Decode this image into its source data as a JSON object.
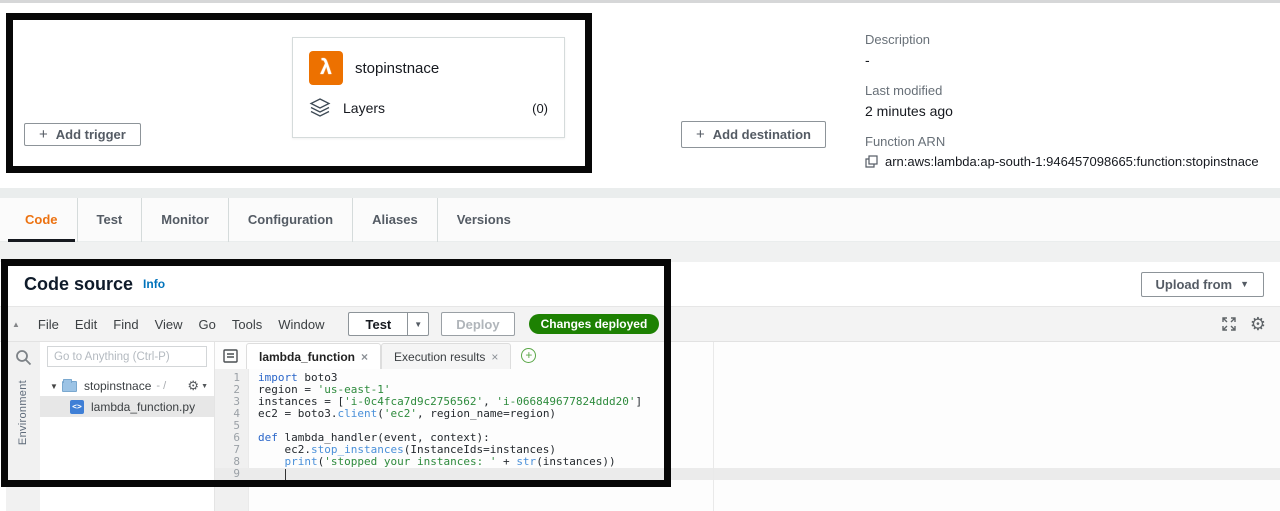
{
  "overview": {
    "function_card": {
      "name": "stopinstnace",
      "layers_label": "Layers",
      "layers_count": "(0)"
    },
    "add_trigger_label": "Add trigger",
    "add_destination_label": "Add destination",
    "plus_glyph": "+",
    "description_label": "Description",
    "description_value": "-",
    "last_modified_label": "Last modified",
    "last_modified_value": "2 minutes ago",
    "function_arn_label": "Function ARN",
    "function_arn_value": "arn:aws:lambda:ap-south-1:946457098665:function:stopinstnace"
  },
  "tabs": {
    "items": [
      {
        "label": "Code",
        "active": true
      },
      {
        "label": "Test"
      },
      {
        "label": "Monitor"
      },
      {
        "label": "Configuration"
      },
      {
        "label": "Aliases"
      },
      {
        "label": "Versions"
      }
    ]
  },
  "code_source": {
    "title": "Code source",
    "info_link": "Info",
    "upload_from_label": "Upload from",
    "toolbar": {
      "menus": [
        "File",
        "Edit",
        "Find",
        "View",
        "Go",
        "Tools",
        "Window"
      ],
      "test_label": "Test",
      "deploy_label": "Deploy",
      "changes_badge": "Changes deployed"
    },
    "sidebar": {
      "search_placeholder": "Go to Anything (Ctrl-P)",
      "environment_label": "Environment",
      "folder_name": "stopinstnace",
      "folder_suffix": "- /",
      "file_name": "lambda_function.py",
      "file_icon_glyph": "<>"
    },
    "editor": {
      "tabs": [
        {
          "label": "lambda_function"
        },
        {
          "label": "Execution results"
        }
      ],
      "close_glyph": "×",
      "highlighted_line": 9,
      "code_lines": [
        [
          {
            "t": "kw",
            "v": "import"
          },
          {
            "t": "pl",
            "v": " boto3"
          }
        ],
        [
          {
            "t": "pl",
            "v": "region = "
          },
          {
            "t": "str",
            "v": "'us-east-1'"
          }
        ],
        [
          {
            "t": "pl",
            "v": "instances = ["
          },
          {
            "t": "str",
            "v": "'i-0c4fca7d9c2756562'"
          },
          {
            "t": "pl",
            "v": ", "
          },
          {
            "t": "str",
            "v": "'i-066849677824ddd20'"
          },
          {
            "t": "pl",
            "v": "]"
          }
        ],
        [
          {
            "t": "pl",
            "v": "ec2 = boto3."
          },
          {
            "t": "fn",
            "v": "client"
          },
          {
            "t": "pl",
            "v": "("
          },
          {
            "t": "str",
            "v": "'ec2'"
          },
          {
            "t": "pl",
            "v": ", region_name=region)"
          }
        ],
        [],
        [
          {
            "t": "kw",
            "v": "def"
          },
          {
            "t": "pl",
            "v": " lambda_handler(event, context):"
          }
        ],
        [
          {
            "t": "pl",
            "v": "    ec2."
          },
          {
            "t": "fn",
            "v": "stop_instances"
          },
          {
            "t": "pl",
            "v": "(InstanceIds=instances)"
          }
        ],
        [
          {
            "t": "pl",
            "v": "    "
          },
          {
            "t": "fn",
            "v": "print"
          },
          {
            "t": "pl",
            "v": "("
          },
          {
            "t": "str",
            "v": "'stopped your instances: '"
          },
          {
            "t": "pl",
            "v": " + "
          },
          {
            "t": "fn",
            "v": "str"
          },
          {
            "t": "pl",
            "v": "(instances))"
          }
        ],
        [
          {
            "t": "pl",
            "v": "    "
          },
          {
            "t": "cursor",
            "v": ""
          }
        ]
      ]
    }
  },
  "colors": {
    "aws_orange": "#ec7211",
    "lambda_orange": "#ed7100",
    "success_green": "#1d8102",
    "link_blue": "#0073bb"
  }
}
